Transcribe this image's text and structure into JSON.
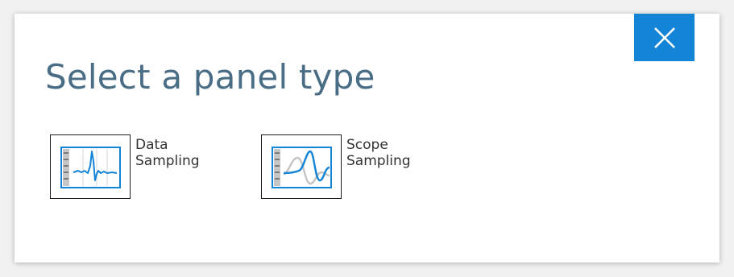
{
  "dialog": {
    "title": "Select a panel type",
    "close_icon": "close-icon",
    "accent_color": "#1484d6",
    "options": [
      {
        "label": "Data\nSampling",
        "icon": "data-sampling-chart-icon"
      },
      {
        "label": "Scope\nSampling",
        "icon": "scope-sampling-chart-icon"
      }
    ]
  }
}
